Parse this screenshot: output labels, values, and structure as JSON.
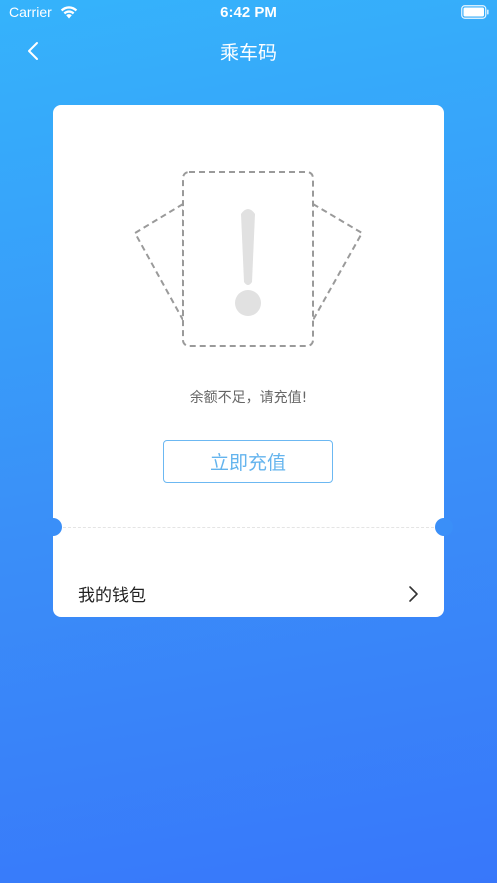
{
  "status_bar": {
    "carrier": "Carrier",
    "time": "6:42 PM"
  },
  "nav": {
    "title": "乘车码",
    "back_icon": "chevron-left-icon"
  },
  "card": {
    "illustration_icon": "exclamation-cards-icon",
    "message": "余额不足，请充值!",
    "recharge_button_label": "立即充值",
    "wallet_label": "我的钱包",
    "wallet_icon": "chevron-right-icon"
  },
  "colors": {
    "gradient_top": "#35b3fb",
    "gradient_bottom": "#3877fa",
    "button_border": "#6cb8f2",
    "button_text": "#64b4ee"
  }
}
